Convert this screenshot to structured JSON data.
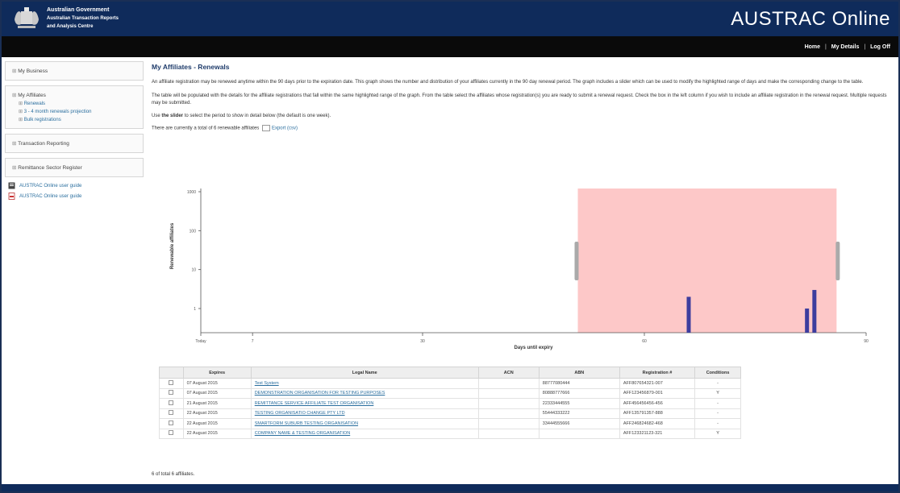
{
  "header": {
    "gov_line1": "Australian Government",
    "gov_line2": "Australian Transaction Reports",
    "gov_line3": "and Analysis Centre",
    "brand": "AUSTRAC Online"
  },
  "topnav": {
    "home": "Home",
    "details": "My Details",
    "logoff": "Log Off",
    "separator": "|"
  },
  "sidebar": {
    "business": "My Business",
    "affiliates": "My Affiliates",
    "affiliate_items": [
      "Renewals",
      "3 - 4 month renewals projection",
      "Bulk registrations"
    ],
    "transaction": "Transaction Reporting",
    "remittance": "Remittance Sector Register",
    "guides": [
      "AUSTRAC Online user guide",
      "AUSTRAC Online user guide"
    ]
  },
  "main": {
    "title": "My Affiliates - Renewals",
    "para1": "An affiliate registration may be renewed anytime within the 90 days prior to the expiration date. This graph shows the number and distribution of your affiliates currently in the 90 day renewal period. The graph includes a slider which can be used to modify the highlighted range of days and make the corresponding change to the table.",
    "para2": "The table will be populated with the details for the affiliate registrations that fall within the same highlighted range of the graph. From the table select the affiliates whose registration(s) you are ready to submit a renewal request. Check the box in the left column if you wish to include an affiliate registration in the renewal request. Multiple requests may be submitted.",
    "slider_note_pre": "Use ",
    "slider_note_bold": "the slider",
    "slider_note_post": " to select the period to show in detail below (the default is one week).",
    "total_text": "There are currently a total of 6 renewable affiliates",
    "export_label": "Export (csv)",
    "bottom_total": "6 of total 6 affiliates."
  },
  "table": {
    "headers": [
      "",
      "Expires",
      "Legal Name",
      "ACN",
      "ABN",
      "Registration #",
      "Conditions"
    ],
    "rows": [
      {
        "expires": "07 August 2015",
        "name": "Test System",
        "acn": "",
        "abn": "88777080444",
        "reg": "AFF807654321-007",
        "cond": "-"
      },
      {
        "expires": "07 August 2015",
        "name": "DEMONSTRATION ORGANISATION FOR TESTING PURPOSES",
        "acn": "",
        "abn": "80888777666",
        "reg": "AFF123456879-001",
        "cond": "Y"
      },
      {
        "expires": "21 August 2015",
        "name": "REMITTANCE SERVICE AFFILIATE TEST ORGANISATION",
        "acn": "",
        "abn": "22333444555",
        "reg": "AFF456456456-456",
        "cond": "-"
      },
      {
        "expires": "22 August 2015",
        "name": "TESTING ORGANISATIO CHANGE PTY LTD",
        "acn": "",
        "abn": "55444333222",
        "reg": "AFF135791357-888",
        "cond": "-"
      },
      {
        "expires": "22 August 2015",
        "name": "SMARTFORM SUBURB TESTING ORGANISATION",
        "acn": "",
        "abn": "33444555666",
        "reg": "AFF246824682-468",
        "cond": "-"
      },
      {
        "expires": "22 August 2015",
        "name": "COMPANY NAME & TESTING ORGANISATION",
        "acn": "",
        "abn": "",
        "reg": "AFF123321123-321",
        "cond": "Y"
      }
    ]
  },
  "chart_data": {
    "type": "bar",
    "xlabel": "Days until expiry",
    "ylabel": "Renewable affiliates",
    "y_scale": "log",
    "ylim": [
      1,
      1000
    ],
    "y_ticks": [
      "1000",
      "100",
      "10",
      "1"
    ],
    "xlim": [
      0,
      90
    ],
    "x_ticks": [
      {
        "v": 0,
        "label": "Today"
      },
      {
        "v": 7,
        "label": "7"
      },
      {
        "v": 30,
        "label": "30"
      },
      {
        "v": 60,
        "label": "60"
      },
      {
        "v": 90,
        "label": "90"
      }
    ],
    "bars": [
      {
        "x": 66,
        "value": 2
      },
      {
        "x": 82,
        "value": 1
      },
      {
        "x": 83,
        "value": 3
      }
    ],
    "highlight_range": [
      51,
      86
    ],
    "colors": {
      "bar": "#3d3d9e",
      "highlight": "#fdc8c8",
      "handle": "#aaaaaa"
    }
  }
}
